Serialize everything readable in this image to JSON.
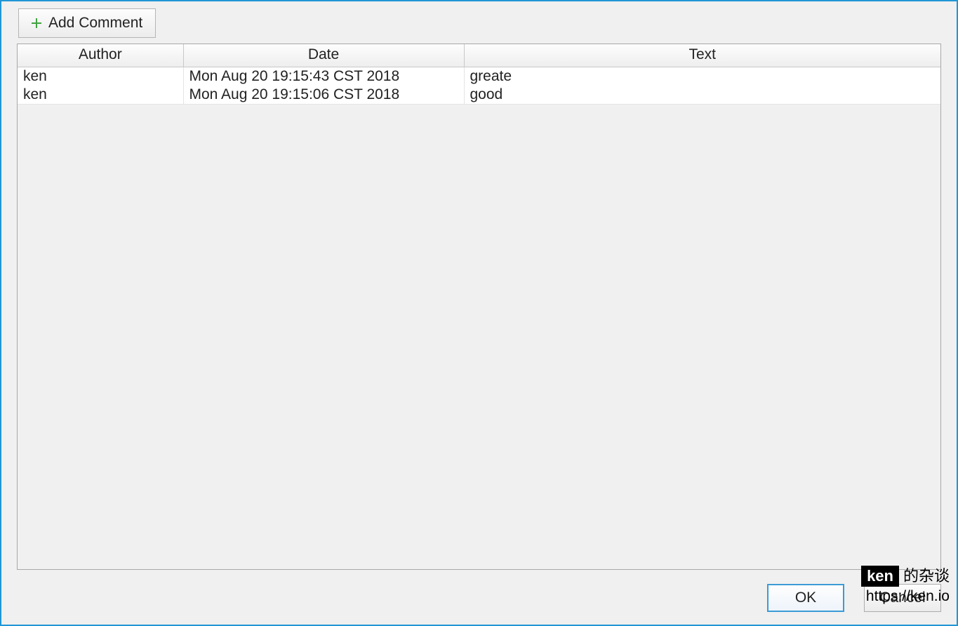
{
  "toolbar": {
    "add_comment_label": "Add Comment"
  },
  "table": {
    "headers": {
      "author": "Author",
      "date": "Date",
      "text": "Text"
    },
    "rows": [
      {
        "author": "ken",
        "date": "Mon Aug 20 19:15:43 CST 2018",
        "text": "greate"
      },
      {
        "author": "ken",
        "date": "Mon Aug 20 19:15:06 CST 2018",
        "text": "good"
      }
    ]
  },
  "buttons": {
    "ok": "OK",
    "cancel": "Cancel"
  },
  "watermark": {
    "name": "ken",
    "suffix": "的杂谈",
    "url": "https://ken.io"
  }
}
